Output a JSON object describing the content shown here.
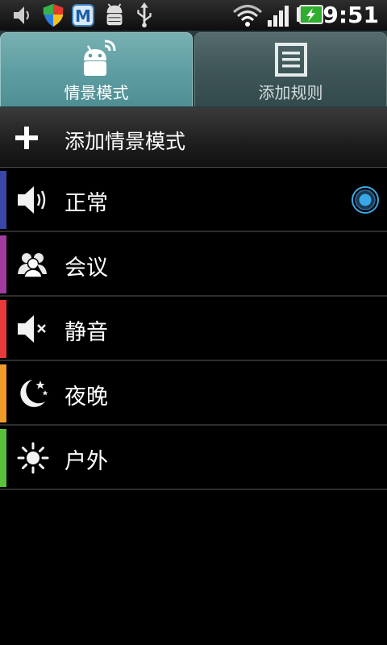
{
  "status_bar": {
    "time": "9:51",
    "icons": [
      "volume-icon",
      "shield-icon",
      "app-m-icon",
      "android-debug-icon",
      "usb-icon",
      "wifi-icon",
      "signal-icon",
      "battery-charging-icon"
    ]
  },
  "tabs": [
    {
      "label": "情景模式",
      "icon": "profile-icon",
      "active": true
    },
    {
      "label": "添加规则",
      "icon": "rules-list-icon",
      "active": false
    }
  ],
  "add_profile": {
    "label": "添加情景模式",
    "icon": "plus-icon"
  },
  "profiles": [
    {
      "label": "正常",
      "icon": "speaker-icon",
      "color": "#3a47a8",
      "selected": true
    },
    {
      "label": "会议",
      "icon": "people-icon",
      "color": "#a13ba0",
      "selected": false
    },
    {
      "label": "静音",
      "icon": "mute-icon",
      "color": "#e83a3a",
      "selected": false
    },
    {
      "label": "夜晚",
      "icon": "moon-icon",
      "color": "#f09a2a",
      "selected": false
    },
    {
      "label": "户外",
      "icon": "sun-icon",
      "color": "#59c13c",
      "selected": false
    }
  ],
  "colors": {
    "tab_active": "#5f9fa3",
    "tab_inactive": "#3f5658",
    "radio_selected": "#3aa8e8"
  }
}
